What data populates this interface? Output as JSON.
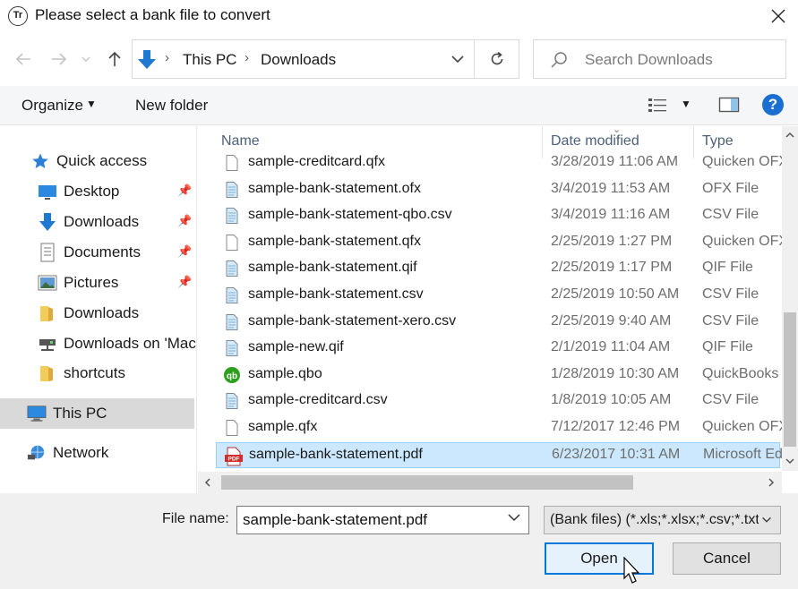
{
  "window": {
    "app_icon": "Tr",
    "title": "Please select a bank file to convert",
    "close_icon": "close-icon"
  },
  "address_bar": {
    "crumbs": [
      "This PC",
      "Downloads"
    ],
    "search_placeholder": "Search Downloads"
  },
  "toolbar": {
    "organize_label": "Organize",
    "new_folder_label": "New folder",
    "help_label": "?"
  },
  "nav": {
    "quick_access": "Quick access",
    "items": [
      {
        "label": "Desktop",
        "icon": "desktop-icon",
        "pinned": true
      },
      {
        "label": "Downloads",
        "icon": "download-arrow-icon",
        "pinned": true
      },
      {
        "label": "Documents",
        "icon": "documents-icon",
        "pinned": true
      },
      {
        "label": "Pictures",
        "icon": "pictures-icon",
        "pinned": true
      },
      {
        "label": "Downloads",
        "icon": "folder-icon",
        "pinned": false
      },
      {
        "label": "Downloads on 'Mac",
        "icon": "network-drive-icon",
        "pinned": false
      },
      {
        "label": "shortcuts",
        "icon": "folder-icon",
        "pinned": false
      }
    ],
    "this_pc": "This PC",
    "network": "Network"
  },
  "columns": {
    "name": "Name",
    "date_modified": "Date modified",
    "type": "Type"
  },
  "files": [
    {
      "name": "sample-creditcard.qfx",
      "date": "3/28/2019 11:06 AM",
      "type": "Quicken OFX",
      "icon": "blank-file-icon"
    },
    {
      "name": "sample-bank-statement.ofx",
      "date": "3/4/2019 11:53 AM",
      "type": "OFX File",
      "icon": "text-file-icon"
    },
    {
      "name": "sample-bank-statement-qbo.csv",
      "date": "3/4/2019 11:16 AM",
      "type": "CSV File",
      "icon": "text-file-icon"
    },
    {
      "name": "sample-bank-statement.qfx",
      "date": "2/25/2019 1:27 PM",
      "type": "Quicken OFX",
      "icon": "blank-file-icon"
    },
    {
      "name": "sample-bank-statement.qif",
      "date": "2/25/2019 1:17 PM",
      "type": "QIF File",
      "icon": "text-file-icon"
    },
    {
      "name": "sample-bank-statement.csv",
      "date": "2/25/2019 10:50 AM",
      "type": "CSV File",
      "icon": "text-file-icon"
    },
    {
      "name": "sample-bank-statement-xero.csv",
      "date": "2/25/2019 9:40 AM",
      "type": "CSV File",
      "icon": "text-file-icon"
    },
    {
      "name": "sample-new.qif",
      "date": "2/1/2019 11:04 AM",
      "type": "QIF File",
      "icon": "text-file-icon"
    },
    {
      "name": "sample.qbo",
      "date": "1/28/2019 10:30 AM",
      "type": "QuickBooks",
      "icon": "quickbooks-icon"
    },
    {
      "name": "sample-creditcard.csv",
      "date": "1/8/2019 10:05 AM",
      "type": "CSV File",
      "icon": "text-file-icon"
    },
    {
      "name": "sample.qfx",
      "date": "7/12/2017 12:46 PM",
      "type": "Quicken OFX",
      "icon": "blank-file-icon"
    },
    {
      "name": "sample-bank-statement.pdf",
      "date": "6/23/2017 10:31 AM",
      "type": "Microsoft Edge",
      "icon": "pdf-icon",
      "selected": true
    }
  ],
  "footer": {
    "file_name_label": "File name:",
    "file_name_value": "sample-bank-statement.pdf",
    "filter_value": "(Bank files) (*.xls;*.xlsx;*.csv;*.txt",
    "open_label": "Open",
    "cancel_label": "Cancel"
  },
  "colors": {
    "accent": "#0078d7",
    "selection": "#cce8ff",
    "help": "#1a6fd1",
    "quickbooks": "#2ca01c",
    "pdf": "#d62b2b"
  }
}
